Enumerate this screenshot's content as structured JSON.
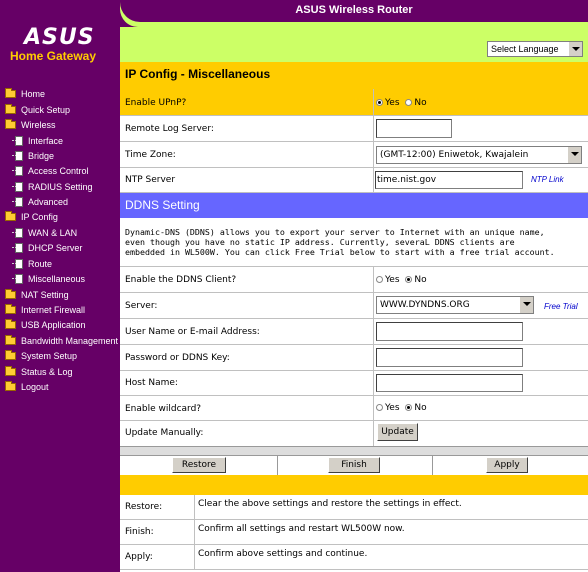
{
  "app_title": "ASUS Wireless Router",
  "logo": {
    "brand": "ASUS",
    "subtitle": "Home Gateway"
  },
  "sidebar": {
    "items": [
      {
        "label": "Home",
        "icon": "folder-icon"
      },
      {
        "label": "Quick Setup",
        "icon": "folder-icon"
      },
      {
        "label": "Wireless",
        "icon": "folder-icon"
      },
      {
        "label": "Interface",
        "icon": "page-icon"
      },
      {
        "label": "Bridge",
        "icon": "page-icon"
      },
      {
        "label": "Access Control",
        "icon": "page-icon"
      },
      {
        "label": "RADIUS Setting",
        "icon": "page-icon"
      },
      {
        "label": "Advanced",
        "icon": "page-icon"
      },
      {
        "label": "IP Config",
        "icon": "folder-icon"
      },
      {
        "label": "WAN & LAN",
        "icon": "page-icon"
      },
      {
        "label": "DHCP Server",
        "icon": "page-icon"
      },
      {
        "label": "Route",
        "icon": "page-icon"
      },
      {
        "label": "Miscellaneous",
        "icon": "page-icon"
      },
      {
        "label": "NAT Setting",
        "icon": "folder-icon"
      },
      {
        "label": "Internet Firewall",
        "icon": "folder-icon"
      },
      {
        "label": "USB Application",
        "icon": "folder-icon"
      },
      {
        "label": "Bandwidth Management",
        "icon": "folder-icon"
      },
      {
        "label": "System Setup",
        "icon": "folder-icon"
      },
      {
        "label": "Status & Log",
        "icon": "folder-icon"
      },
      {
        "label": "Logout",
        "icon": "folder-icon"
      }
    ]
  },
  "language": {
    "selected": "Select Language"
  },
  "page_title": "IP Config - Miscellaneous",
  "misc": {
    "upnp_label": "Enable UPnP?",
    "upnp_yes": "Yes",
    "upnp_no": "No",
    "remote_log_label": "Remote Log Server:",
    "remote_log_value": "",
    "timezone_label": "Time Zone:",
    "timezone_value": "(GMT-12:00) Eniwetok, Kwajalein",
    "ntp_label": "NTP Server",
    "ntp_value": "time.nist.gov",
    "ntp_link": "NTP Link"
  },
  "ddns": {
    "header": "DDNS Setting",
    "description_lines": [
      "Dynamic-DNS (DDNS) allows you to export your server to Internet with an unique name,",
      "even though you have no static IP address. Currently, severaL DDNS clients are",
      "embedded in WL500W. You can click Free Trial below to start with a free trial account."
    ],
    "enable_label": "Enable the DDNS Client?",
    "enable_yes": "Yes",
    "enable_no": "No",
    "server_label": "Server:",
    "server_value": "WWW.DYNDNS.ORG",
    "free_trial": "Free Trial",
    "user_label": "User Name or E-mail Address:",
    "password_label": "Password or DDNS Key:",
    "host_label": "Host Name:",
    "wildcard_label": "Enable wildcard?",
    "wildcard_yes": "Yes",
    "wildcard_no": "No",
    "update_label": "Update Manually:",
    "update_button": "Update"
  },
  "actions": {
    "restore": "Restore",
    "finish": "Finish",
    "apply": "Apply"
  },
  "help": [
    {
      "key": "Restore:",
      "text": "Clear the above settings and restore the settings in effect."
    },
    {
      "key": "Finish:",
      "text": "Confirm all settings and restart WL500W now."
    },
    {
      "key": "Apply:",
      "text": "Confirm above settings and continue."
    }
  ],
  "colors": {
    "purple": "#660066",
    "lime": "#ccff66",
    "gold": "#ffcc00",
    "ddns_blue": "#6666ff"
  }
}
